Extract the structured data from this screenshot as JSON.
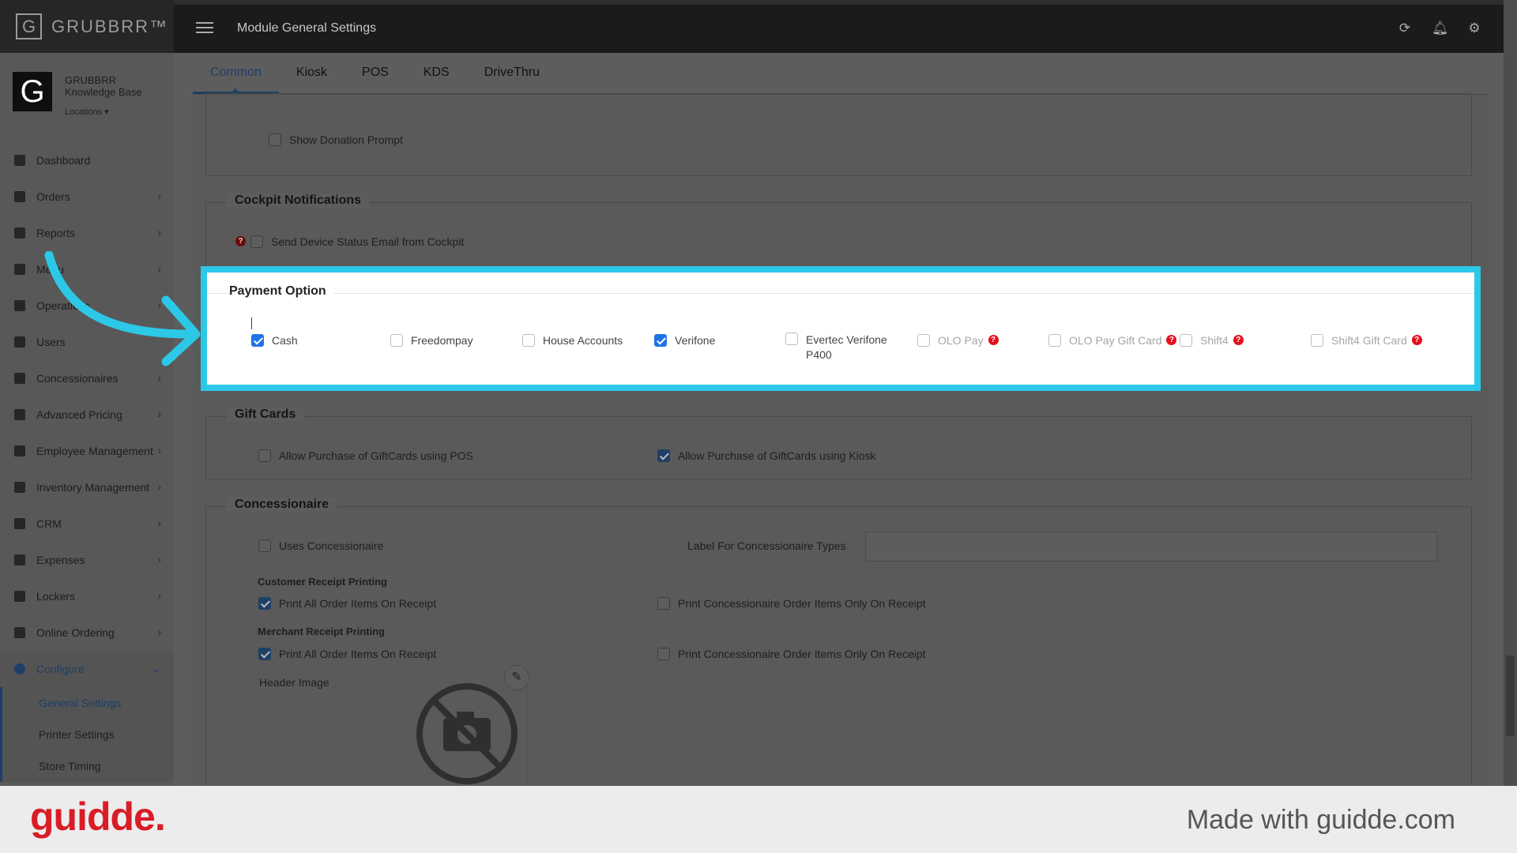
{
  "app": {
    "logo_letter": "G",
    "logo_text": "GRUBBRR™",
    "module_title": "Module General Settings",
    "icons": [
      "refresh-icon",
      "bell-icon",
      "gear-icon"
    ]
  },
  "sidebar": {
    "avatar_letter": "G",
    "org_name": "GRUBBRR Knowledge Base",
    "locations_label": "Locations ▾",
    "items": [
      {
        "label": "Dashboard",
        "icon": "dashboard-icon"
      },
      {
        "label": "Orders",
        "icon": "cart-icon"
      },
      {
        "label": "Reports",
        "icon": "report-icon"
      },
      {
        "label": "Menu",
        "icon": "menu-list-icon"
      },
      {
        "label": "Operations",
        "icon": "flask-icon"
      },
      {
        "label": "Users",
        "icon": "users-icon"
      },
      {
        "label": "Concessionaires",
        "icon": "list-icon"
      },
      {
        "label": "Advanced Pricing",
        "icon": "money-icon"
      },
      {
        "label": "Employee Management",
        "icon": "employees-icon"
      },
      {
        "label": "Inventory Management",
        "icon": "sitemap-icon"
      },
      {
        "label": "CRM",
        "icon": "link-icon"
      },
      {
        "label": "Expenses",
        "icon": "balance-icon"
      },
      {
        "label": "Lockers",
        "icon": "locker-icon"
      },
      {
        "label": "Online Ordering",
        "icon": "globe-icon"
      },
      {
        "label": "Configure",
        "icon": "cog-icon"
      }
    ],
    "configure_sub": [
      "General Settings",
      "Printer Settings",
      "Store Timing"
    ]
  },
  "tabs": [
    "Common",
    "Kiosk",
    "POS",
    "KDS",
    "DriveThru"
  ],
  "active_tab": "Common",
  "donation": {
    "label": "Show Donation Prompt",
    "checked": false
  },
  "cockpit": {
    "title": "Cockpit Notifications",
    "option": {
      "label": "Send Device Status Email from Cockpit",
      "checked": false
    }
  },
  "payment": {
    "title": "Payment Option",
    "options": [
      {
        "label": "Cash",
        "checked": true,
        "disabled": false,
        "help": false
      },
      {
        "label": "Freedompay",
        "checked": false,
        "disabled": false,
        "help": false
      },
      {
        "label": "House Accounts",
        "checked": false,
        "disabled": false,
        "help": false
      },
      {
        "label": "Verifone",
        "checked": true,
        "disabled": false,
        "help": false
      },
      {
        "label": "Evertec Verifone P400",
        "checked": false,
        "disabled": false,
        "help": false
      },
      {
        "label": "OLO Pay",
        "checked": false,
        "disabled": true,
        "help": true
      },
      {
        "label": "OLO Pay Gift Card",
        "checked": false,
        "disabled": true,
        "help": true
      },
      {
        "label": "Shift4",
        "checked": false,
        "disabled": true,
        "help": true
      },
      {
        "label": "Shift4 Gift Card",
        "checked": false,
        "disabled": true,
        "help": true
      }
    ]
  },
  "gift_cards": {
    "title": "Gift Cards",
    "options": [
      {
        "label": "Allow Purchase of GiftCards using POS",
        "checked": false
      },
      {
        "label": "Allow Purchase of GiftCards using Kiosk",
        "checked": true
      }
    ]
  },
  "concessionaire": {
    "title": "Concessionaire",
    "uses_label": "Uses Concessionaire",
    "uses_checked": false,
    "types_label": "Label For Concessionaire Types",
    "types_value": "",
    "customer_heading": "Customer Receipt Printing",
    "customer_all": {
      "label": "Print All Order Items On Receipt",
      "checked": true
    },
    "customer_only": {
      "label": "Print Concessionaire Order Items Only On Receipt",
      "checked": false
    },
    "merchant_heading": "Merchant Receipt Printing",
    "merchant_all": {
      "label": "Print All Order Items On Receipt",
      "checked": true
    },
    "merchant_only": {
      "label": "Print Concessionaire Order Items Only On Receipt",
      "checked": false
    },
    "header_image_label": "Header Image"
  },
  "footer": {
    "brand": "guidde.",
    "made_with": "Made with guidde.com"
  },
  "colors": {
    "highlight": "#2cc8e8",
    "accent": "#1e3f66",
    "checkbox_checked": "#1f74e6",
    "help": "#e4101e",
    "brand": "#d91c26"
  }
}
